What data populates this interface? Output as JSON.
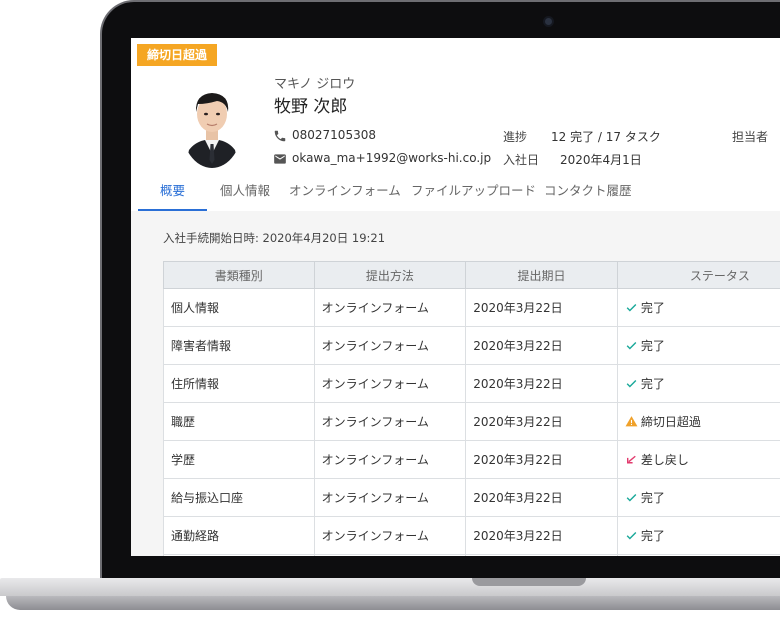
{
  "badge": {
    "label": "締切日超過"
  },
  "employee": {
    "kana": "マキノ ジロウ",
    "name": "牧野 次郎",
    "phone": "08027105308",
    "email": "okawa_ma+1992@works-hi.co.jp"
  },
  "meta": {
    "progress_label": "進捗",
    "progress_value": "12 完了 / 17 タスク",
    "join_label": "入社日",
    "join_value": "2020年4月1日",
    "owner_label": "担当者"
  },
  "tabs": [
    {
      "label": "概要",
      "active": true
    },
    {
      "label": "個人情報"
    },
    {
      "label": "オンラインフォーム"
    },
    {
      "label": "ファイルアップロード"
    },
    {
      "label": "コンタクト履歴"
    }
  ],
  "procedure_start": "入社手続開始日時: 2020年4月20日 19:21",
  "table": {
    "headers": [
      "書類種別",
      "提出方法",
      "提出期日",
      "ステータス"
    ],
    "rows": [
      {
        "type": "個人情報",
        "method": "オンラインフォーム",
        "due": "2020年3月22日",
        "status": "完了",
        "status_kind": "done"
      },
      {
        "type": "障害者情報",
        "method": "オンラインフォーム",
        "due": "2020年3月22日",
        "status": "完了",
        "status_kind": "done"
      },
      {
        "type": "住所情報",
        "method": "オンラインフォーム",
        "due": "2020年3月22日",
        "status": "完了",
        "status_kind": "done"
      },
      {
        "type": "職歴",
        "method": "オンラインフォーム",
        "due": "2020年3月22日",
        "status": "締切日超過",
        "status_kind": "overdue"
      },
      {
        "type": "学歴",
        "method": "オンラインフォーム",
        "due": "2020年3月22日",
        "status": "差し戻し",
        "status_kind": "returned"
      },
      {
        "type": "給与振込口座",
        "method": "オンラインフォーム",
        "due": "2020年3月22日",
        "status": "完了",
        "status_kind": "done"
      },
      {
        "type": "通勤経路",
        "method": "オンラインフォーム",
        "due": "2020年3月22日",
        "status": "完了",
        "status_kind": "done"
      },
      {
        "type": "",
        "method": "",
        "due": "",
        "status": "",
        "status_kind": ""
      }
    ]
  },
  "colors": {
    "accent": "#2a6fd6",
    "badge": "#f5a623",
    "done": "#1aa99a",
    "overdue": "#f0a12a",
    "returned": "#e23b6e"
  }
}
